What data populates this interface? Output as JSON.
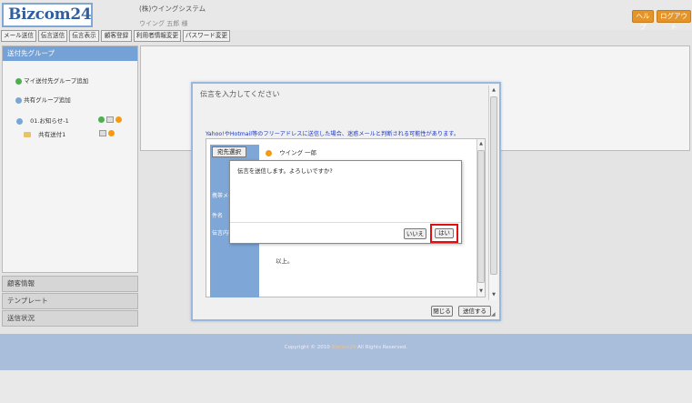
{
  "header": {
    "logo": "Bizcom24",
    "company": "(株)ウイングシステム",
    "user": "ウイング 五郎 様",
    "help_label": "ヘルプ",
    "logout_label": "ログアウト"
  },
  "nav": {
    "items": [
      "メール送信",
      "伝言送信",
      "伝言表示",
      "顧客登録",
      "利用者情報変更",
      "パスワード変更"
    ]
  },
  "sidebar": {
    "header": "送付先グループ",
    "add_my_group": "マイ送付先グループ追加",
    "add_shared_group": "共有グループ追加",
    "group_item": "01.お知らせ-1",
    "subgroup_item": "共有送付1",
    "accordions": [
      "顧客情報",
      "テンプレート",
      "送信状況"
    ]
  },
  "footer": {
    "copyright_pre": "Copyright © 2010",
    "copyright_brand": "Bizcom24",
    "copyright_post": "All Rights Reserved."
  },
  "modal": {
    "title": "伝言を入力してください",
    "notice": "Yahoo!やHotmail等のフリーアドレスに送信した場合、迷惑メールと判断される可能性があります。",
    "address_button": "宛先選択",
    "recipient": "ウイング 一郎",
    "labels": [
      "携帯メー",
      "件名",
      "伝言内容"
    ],
    "body_end": "以上。",
    "close_button": "閉じる",
    "send_button": "送信する"
  },
  "confirm": {
    "message": "伝言を送信します。よろしいですか?",
    "no_label": "いいえ",
    "yes_label": "はい"
  },
  "colors": {
    "accent_blue": "#74a2d6",
    "header_button": "#e3952c",
    "highlight": "#e01010",
    "footer": "#a9bedb"
  }
}
